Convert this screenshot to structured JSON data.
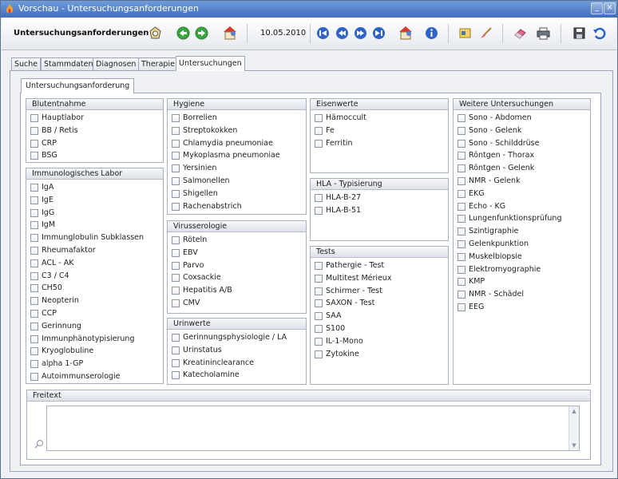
{
  "window": {
    "title": "Vorschau - Untersuchungsanforderungen",
    "minimize": "_",
    "close": "×"
  },
  "toolbar": {
    "title": "Untersuchungsanforderungen",
    "date": "10.05.2010"
  },
  "tabs": [
    {
      "label": "Suche"
    },
    {
      "label": "Stammdaten"
    },
    {
      "label": "Diagnosen"
    },
    {
      "label": "Therapie"
    },
    {
      "label": "Untersuchungen"
    }
  ],
  "subtab": "Untersuchungsanforderung",
  "groups": {
    "blutentnahme": {
      "title": "Blutentnahme",
      "items": [
        "Hauptlabor",
        "BB / Retis",
        "CRP",
        "BSG"
      ]
    },
    "immunologisch": {
      "title": "Immunologisches Labor",
      "items": [
        "IgA",
        "IgE",
        "IgG",
        "IgM",
        "Immunglobulin Subklassen",
        "Rheumafaktor",
        "ACL - AK",
        "C3 / C4",
        "CH50",
        "Neopterin",
        "CCP",
        "Gerinnung",
        "Immunphänotypisierung",
        "Kryoglobuline",
        "alpha 1-GP",
        "Autoimmunserologie"
      ]
    },
    "hygiene": {
      "title": "Hygiene",
      "items": [
        "Borrelien",
        "Streptokokken",
        "Chlamydia pneumoniae",
        "Mykoplasma pneumoniae",
        "Yersinien",
        "Salmonellen",
        "Shigellen",
        "Rachenabstrich"
      ]
    },
    "virusserologie": {
      "title": "Virusserologie",
      "items": [
        "Röteln",
        "EBV",
        "Parvo",
        "Coxsackie",
        "Hepatitis A/B",
        "CMV"
      ]
    },
    "urinwerte": {
      "title": "Urinwerte",
      "items": [
        "Gerinnungsphysiologie / LA",
        "Urinstatus",
        "Kreatininclearance",
        "Katecholamine"
      ]
    },
    "eisenwerte": {
      "title": "Eisenwerte",
      "items": [
        "Hämoccult",
        "Fe",
        "Ferritin"
      ]
    },
    "hla": {
      "title": "HLA - Typisierung",
      "items": [
        "HLA-B-27",
        "HLA-B-51"
      ]
    },
    "tests": {
      "title": "Tests",
      "items": [
        "Pathergie - Test",
        "Multitest Mérieux",
        "Schirmer - Test",
        "SAXON - Test",
        "SAA",
        "S100",
        "IL-1-Mono",
        "Zytokine"
      ]
    },
    "weitere": {
      "title": "Weitere Untersuchungen",
      "items": [
        "Sono - Abdomen",
        "Sono - Gelenk",
        "Sono - Schilddrüse",
        "Röntgen - Thorax",
        "Röntgen - Gelenk",
        "NMR - Gelenk",
        "EKG",
        "Echo - KG",
        "Lungenfunktionsprüfung",
        "Szintigraphie",
        "Gelenkpunktion",
        "Muskelbiopsie",
        "Elektromyographie",
        "KMP",
        "NMR - Schädel",
        "EEG"
      ]
    }
  },
  "freitext": {
    "title": "Freitext",
    "value": ""
  },
  "icons": {
    "app": "flame-icon",
    "home": "home-icon",
    "back": "green-back-icon",
    "forward": "green-forward-icon",
    "patient": "house-person-icon",
    "first": "first-record-icon",
    "prev": "prev-record-icon",
    "next": "next-record-icon",
    "last": "last-record-icon",
    "info": "info-icon",
    "card": "index-card-icon",
    "brush": "brush-icon",
    "eraser": "eraser-icon",
    "print": "printer-icon",
    "save": "save-icon",
    "undo": "undo-icon",
    "search": "magnifier-icon"
  }
}
